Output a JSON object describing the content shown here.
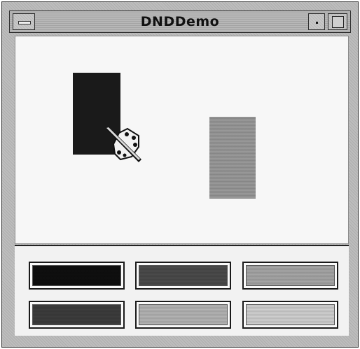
{
  "window": {
    "title": "DNDDemo"
  },
  "icons": {
    "menu": "window-menu-icon",
    "minimize": "minimize-icon",
    "maximize": "maximize-icon",
    "drag_cursor": "paint-palette-cursor-icon"
  },
  "canvas": {
    "shapes": [
      {
        "name": "dark-rectangle",
        "color": "#1a1a1a"
      },
      {
        "name": "gray-rectangle",
        "color": "#9a9a9a"
      }
    ]
  },
  "palette": {
    "swatches": [
      {
        "color": "#0f0f0f"
      },
      {
        "color": "#4a4a4a"
      },
      {
        "color": "#a4a4a4"
      },
      {
        "color": "#3c3c3c"
      },
      {
        "color": "#b2b2b2"
      },
      {
        "color": "#cecece"
      }
    ]
  }
}
